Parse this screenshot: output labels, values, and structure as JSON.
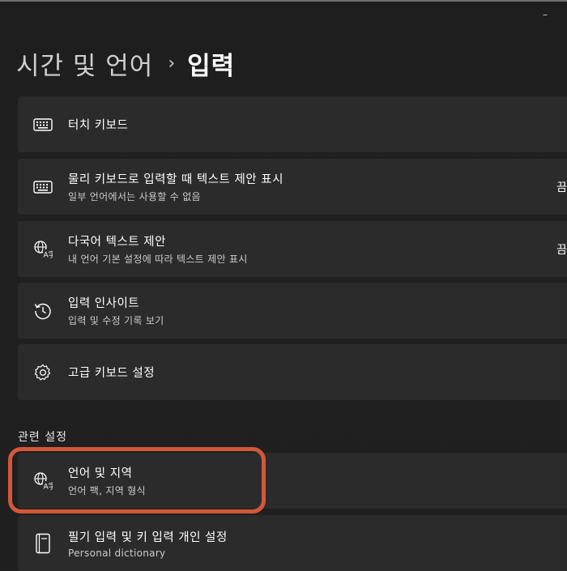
{
  "window": {
    "minimize_glyph": "–"
  },
  "breadcrumb": {
    "parent": "시간 및 언어",
    "separator": "›",
    "current": "입력"
  },
  "cards": [
    {
      "title": "터치 키보드",
      "subtitle": "",
      "status": "",
      "icon": "keyboard-icon"
    },
    {
      "title": "물리 키보드로 입력할 때 텍스트 제안 표시",
      "subtitle": "일부 언어에서는 사용할 수 없음",
      "status": "끔",
      "icon": "keyboard-icon"
    },
    {
      "title": "다국어 텍스트 제안",
      "subtitle": "내 언어 기본 설정에 따라 텍스트 제안 표시",
      "status": "끔",
      "icon": "language-icon"
    },
    {
      "title": "입력 인사이트",
      "subtitle": "입력 및 수정 기록 보기",
      "status": "",
      "icon": "history-icon"
    },
    {
      "title": "고급 키보드 설정",
      "subtitle": "",
      "status": "",
      "icon": "gear-icon"
    }
  ],
  "related": {
    "header": "관련 설정",
    "items": [
      {
        "title": "언어 및 지역",
        "subtitle": "언어 팩, 지역 형식",
        "icon": "language-icon"
      },
      {
        "title": "필기 입력 및 키 입력 개인 설정",
        "subtitle": "Personal dictionary",
        "icon": "notebook-icon"
      }
    ]
  },
  "colors": {
    "background": "#202020",
    "card": "#2b2b2b",
    "highlight": "#d4573a"
  }
}
